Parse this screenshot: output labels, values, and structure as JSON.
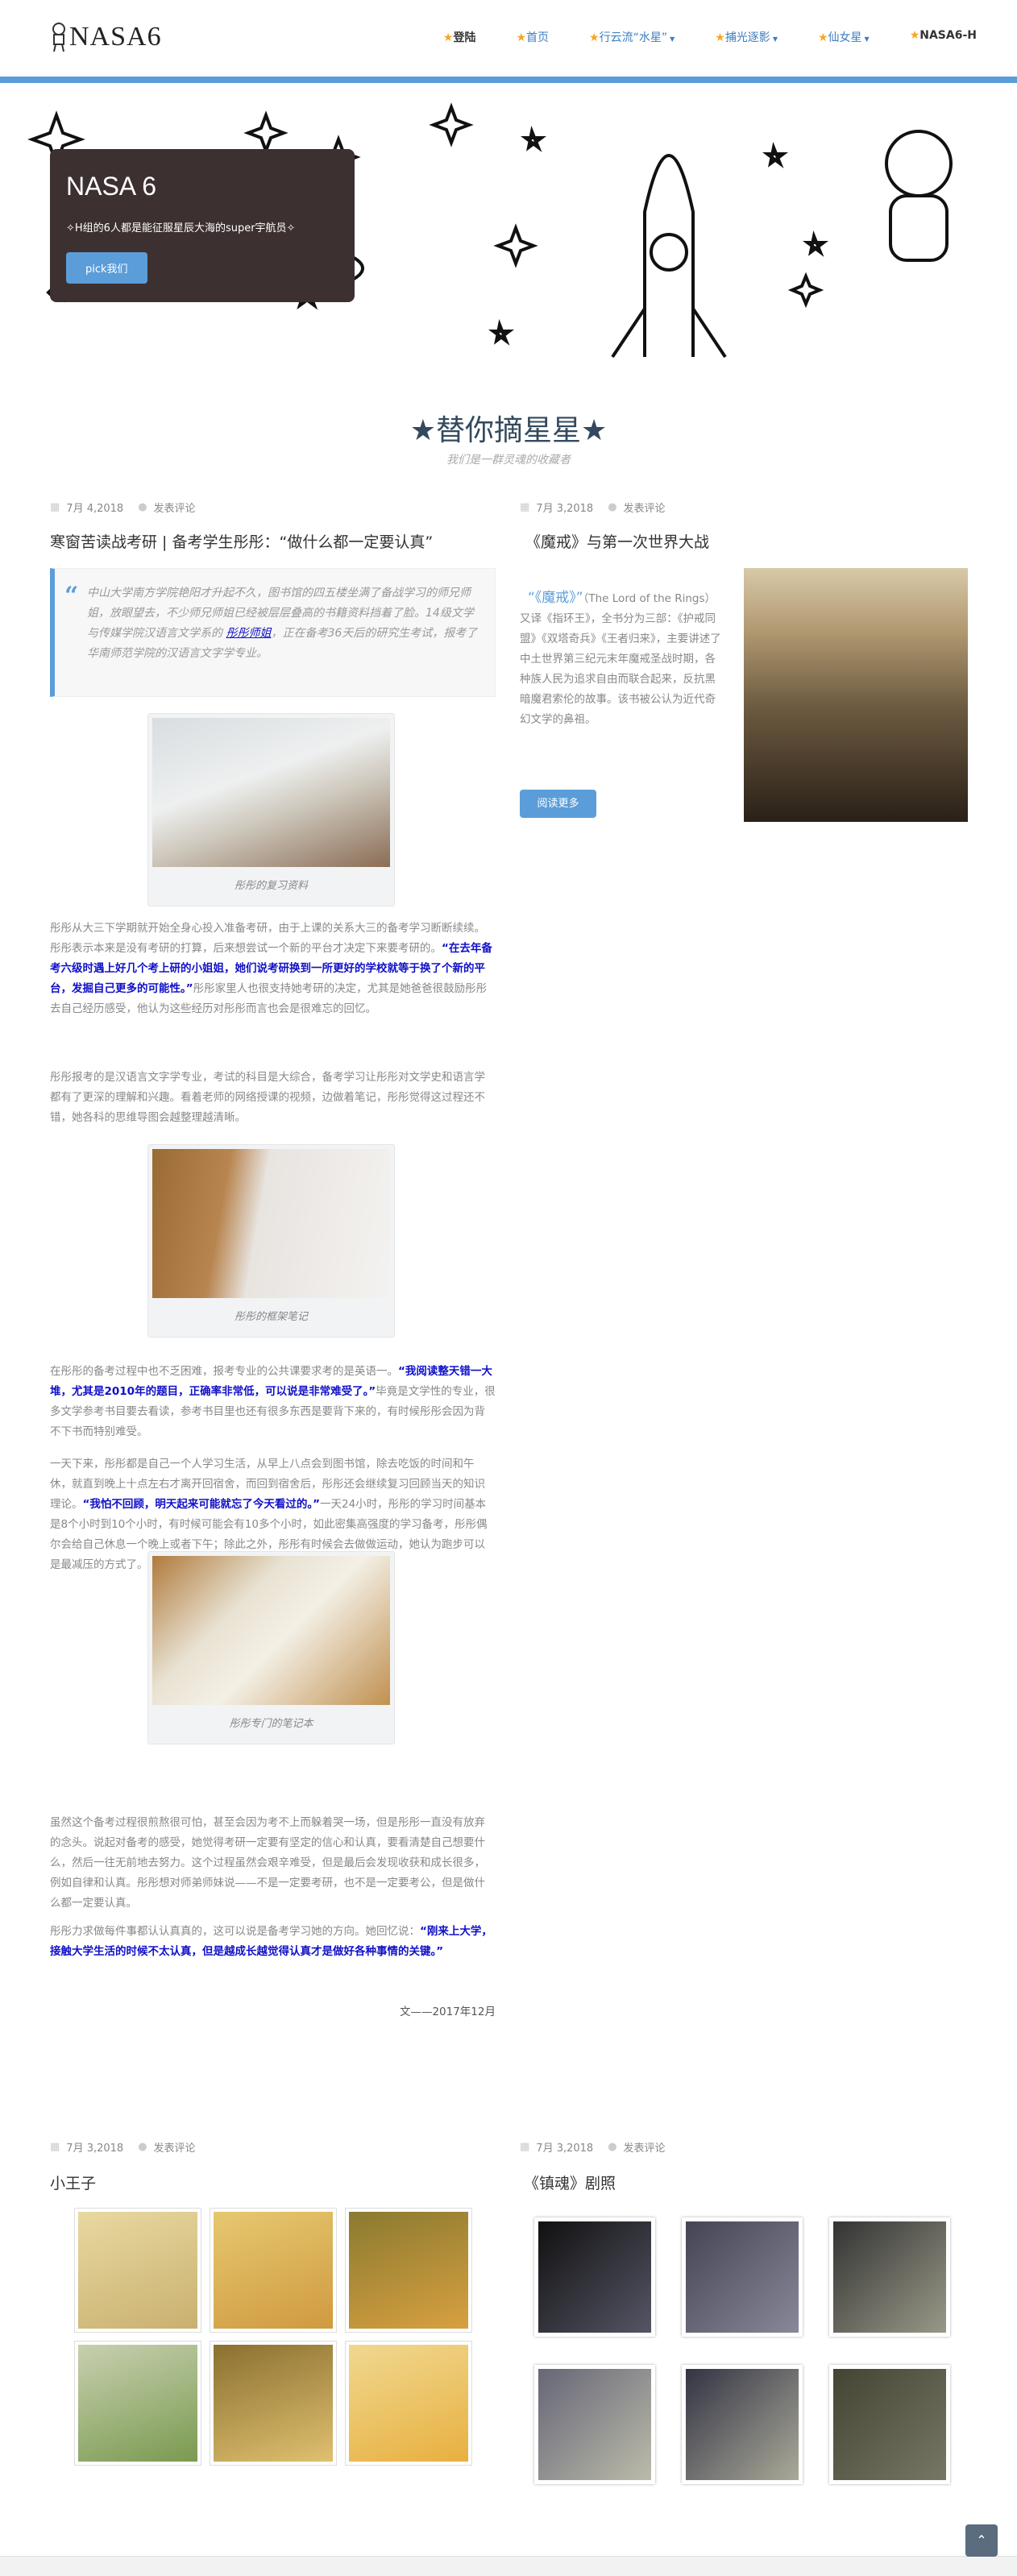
{
  "header": {
    "logo_text": "NASA6",
    "nav": [
      {
        "label": "登陆",
        "dark": true,
        "dropdown": false
      },
      {
        "label": "首页",
        "dark": false,
        "dropdown": false
      },
      {
        "label": "行云流“水星”",
        "dark": false,
        "dropdown": true
      },
      {
        "label": "捕光逐影",
        "dark": false,
        "dropdown": true
      },
      {
        "label": "仙女星",
        "dark": false,
        "dropdown": true
      },
      {
        "label": "NASA6-H",
        "dark": true,
        "dropdown": false
      }
    ],
    "star_icon": "★",
    "accent": "#5b9dd9",
    "star_color": "#f6a623"
  },
  "hero": {
    "title": "NASA 6",
    "subtitle": "✧H组的6人都是能征服星辰大海的super宇航员✧",
    "button": "pick我们"
  },
  "section": {
    "title": "★替你摘星星★",
    "subtitle": "我们是一群灵魂的收藏者"
  },
  "posts": {
    "main": {
      "date": "7月 4,2018",
      "comments": "发表评论",
      "title": "寒窗苦读战考研 | 备考学生彤彤：“做什么都一定要认真”",
      "quote_before": "中山大学南方学院艳阳才升起不久，图书馆的四五楼坐满了备战学习的师兄师姐，放眼望去，不少师兄师姐已经被层层叠高的书籍资料挡着了脸。14级文学与传媒学院汉语言文学系的 ",
      "quote_link": "彤彤师姐",
      "quote_after": "，正在备考36天后的研究生考试，报考了华南师范学院的汉语言文字学专业。",
      "fig1_caption": "彤彤的复习资料",
      "p1_a": "彤彤从大三下学期就开始全身心投入准备考研，由于上课的关系大三的备考学习断断续续。彤彤表示本来是没有考研的打算，后来想尝试一个新的平台才决定下来要考研的。",
      "p1_b": "“在去年备考六级时遇上好几个考上研的小姐姐，她们说考研换到一所更好的学校就等于换了个新的平台，发掘自己更多的可能性。”",
      "p1_c": "彤彤家里人也很支持她考研的决定，尤其是她爸爸很鼓励彤彤去自己经历感受，他认为这些经历对彤彤而言也会是很难忘的回忆。",
      "p2": "彤彤报考的是汉语言文字学专业，考试的科目是大综合，备考学习让彤彤对文学史和语言学都有了更深的理解和兴趣。看着老师的网络授课的视频，边做着笔记，彤彤觉得这过程还不错，她各科的思维导图会越整理越清晰。",
      "fig2_caption": "彤彤的框架笔记",
      "p3_a": "在彤彤的备考过程中也不乏困难，报考专业的公共课要求考的是英语一。",
      "p3_b": "“我阅读整天错一大堆，尤其是2010年的题目，正确率非常低，可以说是非常难受了。”",
      "p3_c": "毕竟是文学性的专业，很多文学参考书目要去看读，参考书目里也还有很多东西是要背下来的，有时候彤彤会因为背不下书而特别难受。",
      "p4_a": "一天下来，彤彤都是自己一个人学习生活，从早上八点会到图书馆，除去吃饭的时间和午休，就直到晚上十点左右才离开回宿舍，而回到宿舍后，彤彤还会继续复习回顾当天的知识理论。",
      "p4_b": "“我怕不回顾，明天起来可能就忘了今天看过的。”",
      "p4_c": "一天24小时，彤彤的学习时间基本是8个小时到10个小时，有时候可能会有10多个小时，如此密集高强度的学习备考，彤彤偶尔会给自己休息一个晚上或者下午；除此之外，彤彤有时候会去做做运动，她认为跑步可以是最减压的方式了。",
      "fig3_caption": "彤彤专门的笔记本",
      "p5": "虽然这个备考过程很煎熬很可怕，甚至会因为考不上而躲着哭一场，但是彤彤一直没有放弃的念头。说起对备考的感受，她觉得考研一定要有坚定的信心和认真，要看清楚自己想要什么，然后一往无前地去努力。这个过程虽然会艰辛难受，但是最后会发现收获和成长很多，例如自律和认真。彤彤想对师弟师妹说——不是一定要考研，也不是一定要考公，但是做什么都一定要认真。",
      "p6_a": "彤彤力求做每件事都认认真真的，这可以说是备考学习她的方向。她回忆说：",
      "p6_b": "“刚来上大学，接触大学生活的时候不太认真，但是越成长越觉得认真才是做好各种事情的关键。”",
      "signature": "文——2017年12月"
    },
    "lotr": {
      "date": "7月 3,2018",
      "comments": "发表评论",
      "title": "《魔戒》与第一次世界大战",
      "link": "“《魔戒》”",
      "text": "（The Lord of the Rings）又译《指环王》，全书分为三部：《护戒同盟》《双塔奇兵》《王者归来》，主要讲述了中土世界第三纪元末年魔戒圣战时期，各种族人民为追求自由而联合起来，反抗黑暗魔君索伦的故事。该书被公认为近代奇幻文学的鼻祖。",
      "button": "阅读更多"
    },
    "prince": {
      "date": "7月 3,2018",
      "comments": "发表评论",
      "title": "小王子"
    },
    "zhenhun": {
      "date": "7月 3,2018",
      "comments": "发表评论",
      "title": "《镇魂》剧照"
    }
  },
  "icons": {
    "calendar": "calendar-icon",
    "comment": "comment-icon",
    "quote": "quote-icon",
    "back_to_top": "chevron-up-icon"
  }
}
